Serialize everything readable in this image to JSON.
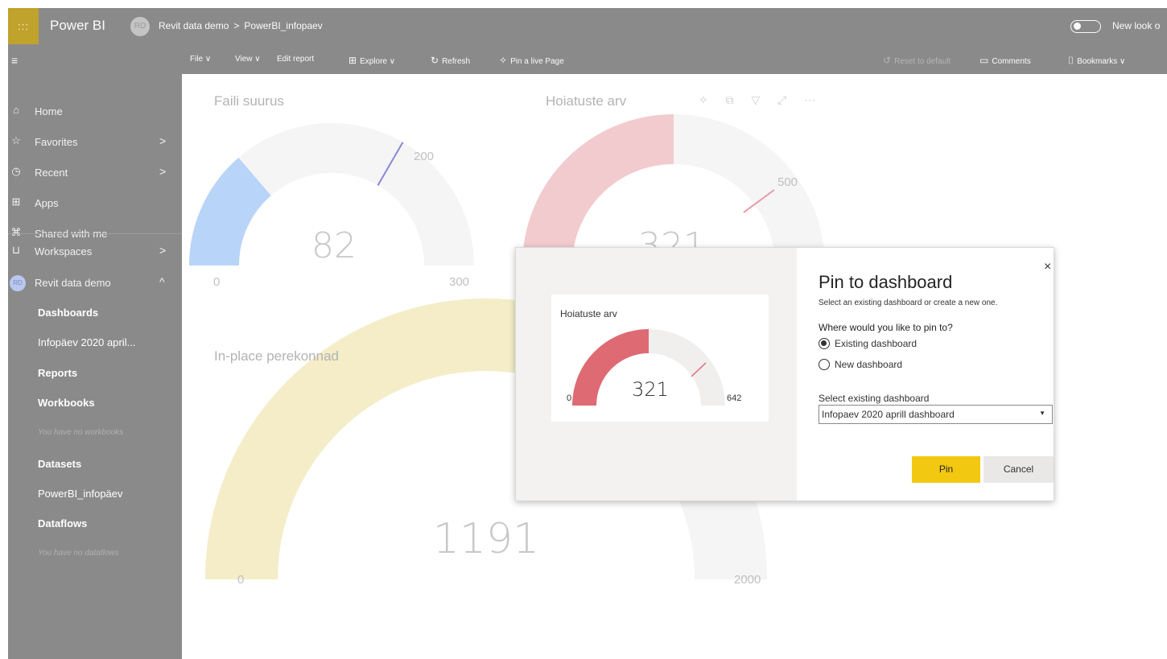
{
  "topbar": {
    "waffle_glyph": ":::",
    "app_name": "Power BI",
    "workspace_avatar_initials": "RD",
    "breadcrumb": [
      "Revit data demo",
      ">",
      "PowerBI_infopaev"
    ],
    "new_look_label": "New look o"
  },
  "commandbar": {
    "menu_glyph": "≡",
    "file": "File ∨",
    "view": "View ∨",
    "edit_report": "Edit report",
    "explore": "Explore ∨",
    "refresh": "Refresh",
    "pin_live_page": "Pin a live Page",
    "reset_to_default": "Reset to default",
    "comments": "Comments",
    "bookmarks": "Bookmarks ∨"
  },
  "nav": {
    "items": [
      {
        "icon": "⌂",
        "label": "Home",
        "chevron": ""
      },
      {
        "icon": "☆",
        "label": "Favorites",
        "chevron": ">"
      },
      {
        "icon": "◷",
        "label": "Recent",
        "chevron": ">"
      },
      {
        "icon": "⊞",
        "label": "Apps",
        "chevron": ""
      },
      {
        "icon": "⌘",
        "label": "Shared with me",
        "chevron": ""
      },
      {
        "icon": "⊔",
        "label": "Workspaces",
        "chevron": ">"
      }
    ],
    "workspace": {
      "avatar": "RD",
      "label": "Revit data demo",
      "chevron": "^"
    },
    "sub_items": [
      {
        "label": "Dashboards",
        "style": "bold"
      },
      {
        "label": "Infopäev 2020 april...",
        "style": "normal"
      },
      {
        "label": "Reports",
        "style": "bold"
      },
      {
        "label": "Workbooks",
        "style": "bold"
      },
      {
        "label": "You have no workbooks",
        "style": "empty"
      },
      {
        "label": "Datasets",
        "style": "bold"
      },
      {
        "label": "PowerBI_infopäev",
        "style": "normal"
      },
      {
        "label": "Dataflows",
        "style": "bold"
      },
      {
        "label": "You have no dataflows",
        "style": "empty"
      }
    ]
  },
  "report": {
    "gauge1": {
      "title": "Faili suurus",
      "value": "82",
      "min": "0",
      "max": "300",
      "target": "200",
      "fill_color": "#b9d4f9",
      "target_color": "#8a87d6"
    },
    "gauge2": {
      "title": "Hoiatuste arv",
      "value": "321",
      "target": "500",
      "fill_color": "#f2cbcf",
      "target_color": "#e89aa3"
    },
    "gauge3": {
      "title": "In-place perekonnad",
      "value": "1191",
      "min": "0",
      "max": "2000",
      "fill_color": "#f4edc8"
    },
    "visual_header_icons": "✧ ⧉ ▽ ⤢ ⋯"
  },
  "dialog": {
    "title": "Pin to dashboard",
    "subtitle": "Select an existing dashboard or create a new one.",
    "question": "Where would you like to pin to?",
    "options": [
      {
        "label": "Existing dashboard",
        "selected": true
      },
      {
        "label": "New dashboard",
        "selected": false
      }
    ],
    "select_label": "Select existing dashboard",
    "select_value": "Infopaev 2020 aprill dashboard",
    "pin_label": "Pin",
    "cancel_label": "Cancel",
    "close_glyph": "×",
    "preview": {
      "title": "Hoiatuste arv",
      "value": "321",
      "min": "0",
      "max": "642",
      "fill_color": "#de6a73"
    }
  }
}
